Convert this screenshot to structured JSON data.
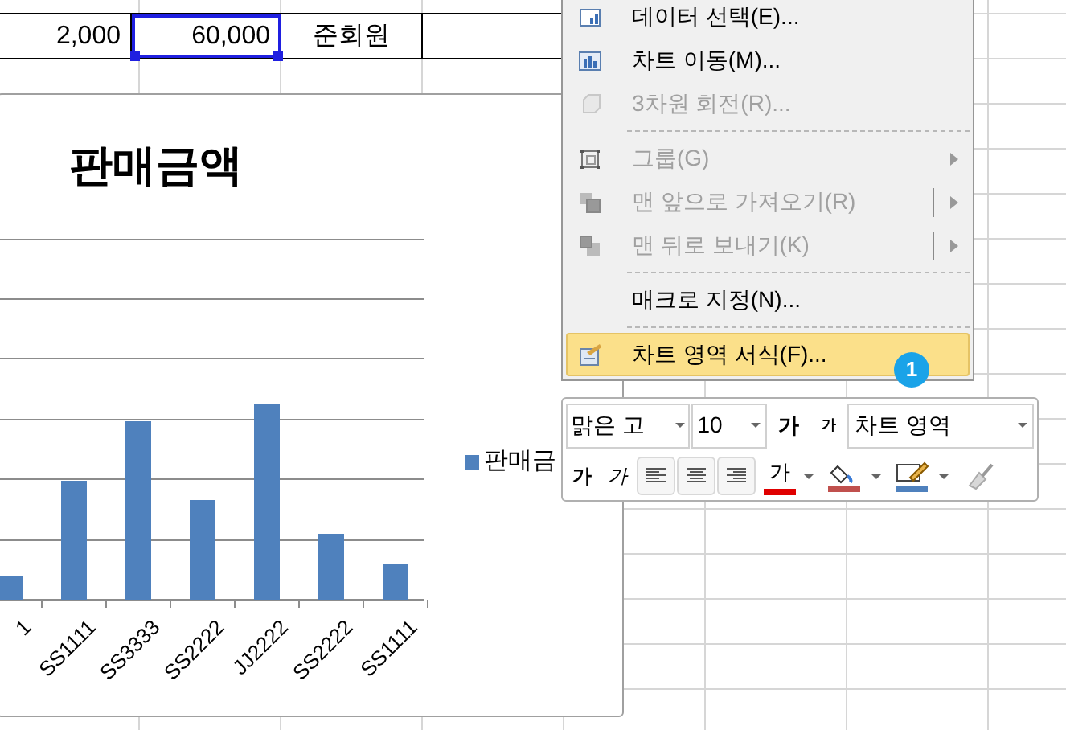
{
  "sheet": {
    "row": [
      {
        "text": "2,000",
        "selected": false
      },
      {
        "text": "60,000",
        "selected": true
      },
      {
        "text": "준회원",
        "selected": false
      }
    ]
  },
  "chart": {
    "title": "판매금액",
    "x_labels": [
      "1",
      "SS1111",
      "SS3333",
      "SS2222",
      "JJ2222",
      "SS2222",
      "SS1111"
    ],
    "legend": "판매금"
  },
  "context_menu": {
    "items": [
      {
        "kind": "item",
        "label": "데이터 선택(E)...",
        "disabled": false,
        "submenu": false,
        "selected": false
      },
      {
        "kind": "item",
        "label": "차트 이동(M)...",
        "disabled": false,
        "submenu": false,
        "selected": false
      },
      {
        "kind": "item",
        "label": "3차원 회전(R)...",
        "disabled": true,
        "submenu": false,
        "selected": false
      },
      {
        "kind": "separator"
      },
      {
        "kind": "item",
        "label": "그룹(G)",
        "disabled": true,
        "submenu": true,
        "selected": false
      },
      {
        "kind": "item",
        "label": "맨 앞으로 가져오기(R)",
        "disabled": true,
        "submenu": true,
        "split": true,
        "selected": false
      },
      {
        "kind": "item",
        "label": "맨 뒤로 보내기(K)",
        "disabled": true,
        "submenu": true,
        "split": true,
        "selected": false
      },
      {
        "kind": "separator"
      },
      {
        "kind": "item",
        "label": "매크로 지정(N)...",
        "disabled": false,
        "submenu": false,
        "selected": false
      },
      {
        "kind": "separator"
      },
      {
        "kind": "item",
        "label": "차트 영역 서식(F)...",
        "disabled": false,
        "submenu": false,
        "selected": true
      }
    ]
  },
  "badge": "1",
  "mini_toolbar": {
    "font": "맑은 고",
    "size": "10",
    "grow": "가",
    "shrink": "가",
    "element": "차트 영역",
    "bold": "가",
    "italic": "가",
    "font_color": "가"
  }
}
